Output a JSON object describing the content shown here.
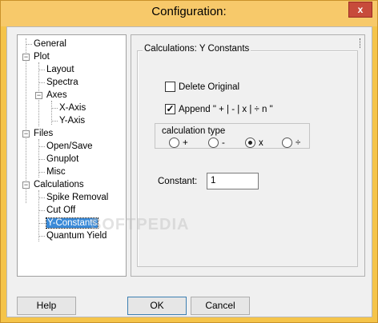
{
  "window": {
    "title": "Configuration:",
    "close_label": "x"
  },
  "tree": {
    "items": [
      {
        "label": "General",
        "level": 0,
        "expander": ""
      },
      {
        "label": "Plot",
        "level": 0,
        "expander": "−"
      },
      {
        "label": "Layout",
        "level": 1,
        "expander": ""
      },
      {
        "label": "Spectra",
        "level": 1,
        "expander": ""
      },
      {
        "label": "Axes",
        "level": 1,
        "expander": "−"
      },
      {
        "label": "X-Axis",
        "level": 2,
        "expander": ""
      },
      {
        "label": "Y-Axis",
        "level": 2,
        "expander": ""
      },
      {
        "label": "Files",
        "level": 0,
        "expander": "−"
      },
      {
        "label": "Open/Save",
        "level": 1,
        "expander": ""
      },
      {
        "label": "Gnuplot",
        "level": 1,
        "expander": ""
      },
      {
        "label": "Misc",
        "level": 1,
        "expander": ""
      },
      {
        "label": "Calculations",
        "level": 0,
        "expander": "−"
      },
      {
        "label": "Spike Removal",
        "level": 1,
        "expander": ""
      },
      {
        "label": "Cut Off",
        "level": 1,
        "expander": ""
      },
      {
        "label": "Y-Constants",
        "level": 1,
        "expander": "",
        "selected": true
      },
      {
        "label": "Quantum Yield",
        "level": 1,
        "expander": ""
      }
    ]
  },
  "panel": {
    "group_title": "Calculations: Y Constants",
    "delete_original": {
      "label": "Delete Original",
      "checked": false
    },
    "append": {
      "label": "Append \" + | - | x | ÷  n \"",
      "checked": true,
      "mark": "✓"
    },
    "calc_type": {
      "title": "calculation type",
      "options": [
        {
          "label": "+",
          "selected": false
        },
        {
          "label": "-",
          "selected": false
        },
        {
          "label": "x",
          "selected": true
        },
        {
          "label": "÷",
          "selected": false
        }
      ]
    },
    "constant": {
      "label": "Constant:",
      "value": "1"
    }
  },
  "buttons": {
    "help": "Help",
    "ok": "OK",
    "cancel": "Cancel"
  },
  "watermark": "SOFTPEDIA"
}
